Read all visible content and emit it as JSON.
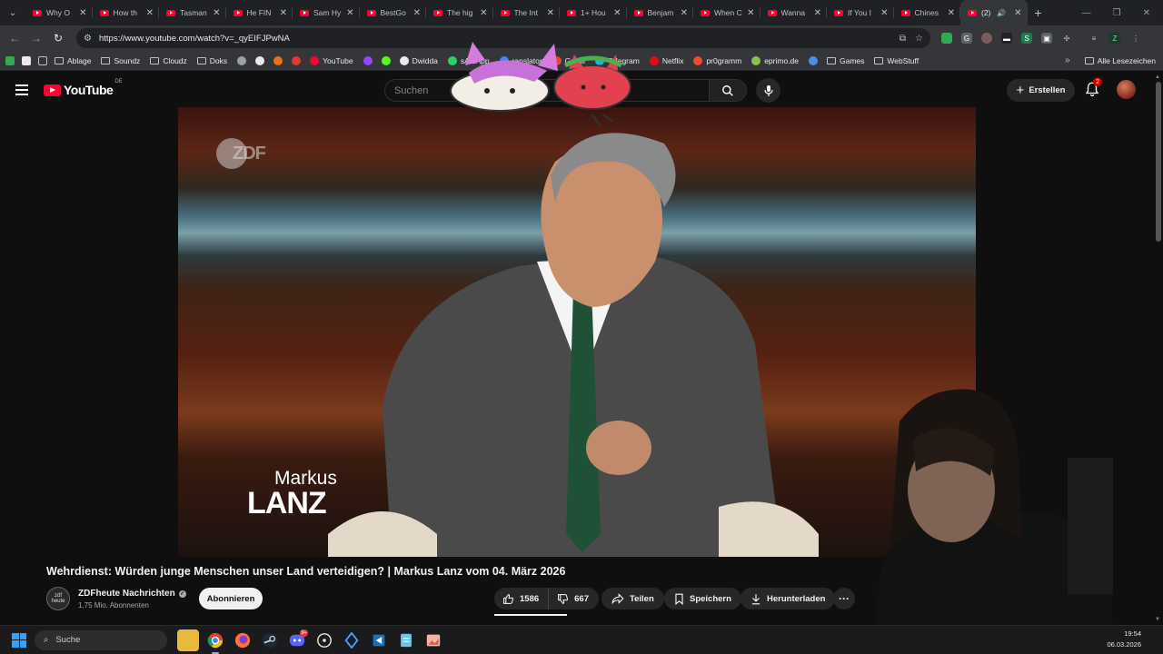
{
  "browser": {
    "tabs": [
      {
        "label": "Why O",
        "active": false
      },
      {
        "label": "How th",
        "active": false
      },
      {
        "label": "Tasman",
        "active": false
      },
      {
        "label": "He FIN",
        "active": false
      },
      {
        "label": "Sam Hy",
        "active": false
      },
      {
        "label": "BestGo",
        "active": false
      },
      {
        "label": "The hig",
        "active": false
      },
      {
        "label": "The Int",
        "active": false
      },
      {
        "label": "1+ Hou",
        "active": false
      },
      {
        "label": "Benjam",
        "active": false
      },
      {
        "label": "When C",
        "active": false
      },
      {
        "label": "Wanna",
        "active": false
      },
      {
        "label": "If You I",
        "active": false
      },
      {
        "label": "Chines",
        "active": false
      },
      {
        "label": "(2)",
        "active": true
      }
    ],
    "url": "https://www.youtube.com/watch?v=_qyEIFJPwNA",
    "bookmarks": [
      {
        "label": "Ablage",
        "type": "folder"
      },
      {
        "label": "Soundz",
        "type": "folder"
      },
      {
        "label": "Cloudz",
        "type": "folder"
      },
      {
        "label": "Doks",
        "type": "folder"
      },
      {
        "label": "",
        "type": "icon",
        "color": "#9aa0a6"
      },
      {
        "label": "",
        "type": "icon",
        "color": "#e8eaed"
      },
      {
        "label": "",
        "type": "icon",
        "color": "#e8711c"
      },
      {
        "label": "",
        "type": "icon",
        "color": "#e53935"
      },
      {
        "label": "YouTube",
        "type": "site",
        "color": "#ff0033"
      },
      {
        "label": "",
        "type": "icon",
        "color": "#9146ff"
      },
      {
        "label": "",
        "type": "icon",
        "color": "#53fc18"
      },
      {
        "label": "Dwidda",
        "type": "site",
        "color": "#e8eaed"
      },
      {
        "label": "sAtsApp",
        "type": "site",
        "color": "#25d366"
      },
      {
        "label": "ranslator",
        "type": "site",
        "color": "#4285f4"
      },
      {
        "label": "Gmail",
        "type": "site",
        "color": "#ea4335"
      },
      {
        "label": "Telegram",
        "type": "site",
        "color": "#2aabee"
      },
      {
        "label": "Netflix",
        "type": "site",
        "color": "#e50914"
      },
      {
        "label": "pr0gramm",
        "type": "site",
        "color": "#ee4d2e"
      },
      {
        "label": "eprimo.de",
        "type": "site",
        "color": "#8bc34a"
      },
      {
        "label": "",
        "type": "icon",
        "color": "#4a90e2"
      },
      {
        "label": "Games",
        "type": "folder"
      },
      {
        "label": "WebStuff",
        "type": "folder"
      }
    ],
    "all_bookmarks": "Alle Lesezeichen",
    "profile_initial": "Z"
  },
  "youtube": {
    "logo_text": "YouTube",
    "country_code": "DE",
    "search_placeholder": "Suchen",
    "create_label": "Erstellen",
    "notification_count": "2"
  },
  "video": {
    "title": "Wehrdienst: Würden junge Menschen unser Land verteidigen? | Markus Lanz vom 04. März 2026",
    "overlay_logo": "ZDF",
    "lower_third_line1": "Markus",
    "lower_third_line2": "LANZ",
    "channel_avatar_text": "zdf heute",
    "channel_name": "ZDFheute Nachrichten",
    "subscribers": "1,75 Mio. Abonnenten",
    "subscribe_label": "Abonnieren",
    "likes": "1586",
    "dislikes": "667",
    "share_label": "Teilen",
    "save_label": "Speichern",
    "download_label": "Herunterladen"
  },
  "taskbar": {
    "search_label": "Suche",
    "time": "19:54",
    "date": "06.03.2026",
    "discord_badge": "9+"
  }
}
